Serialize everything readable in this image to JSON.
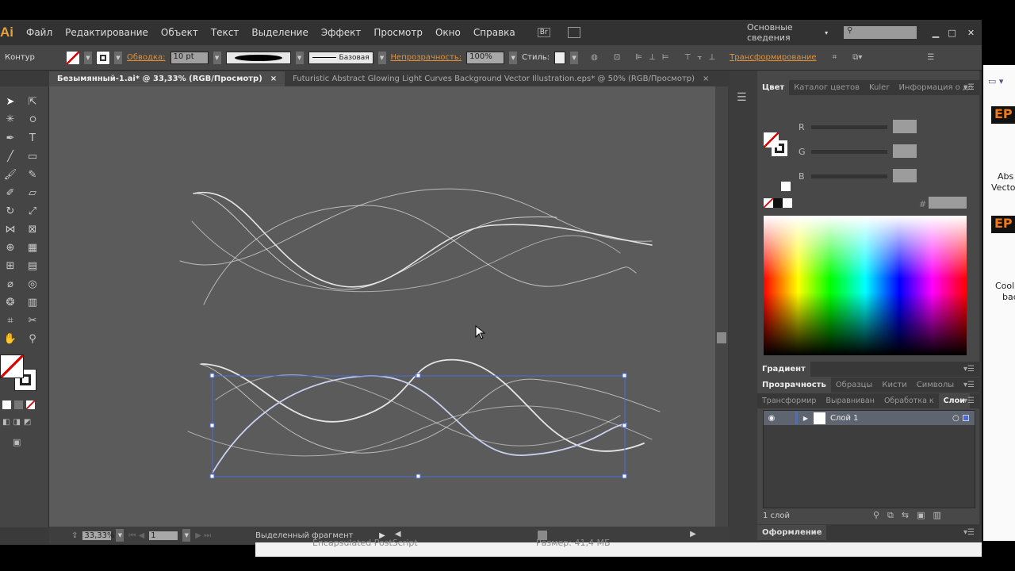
{
  "app": {
    "logo": "Ai",
    "menu": [
      "Файл",
      "Редактирование",
      "Объект",
      "Текст",
      "Выделение",
      "Эффект",
      "Просмотр",
      "Окно",
      "Справка"
    ],
    "bridge": "Br",
    "workspace": "Основные сведения",
    "search_placeholder": ""
  },
  "control": {
    "mode": "Контур",
    "stroke_label": "Обводка:",
    "stroke_weight": "10 pt",
    "profile": "Базовая",
    "opacity_label": "Непрозрачность:",
    "opacity": "100%",
    "styles_label": "Стиль:",
    "transform": "Трансформирование"
  },
  "tabs": [
    {
      "label": "Безымянный-1.ai* @ 33,33% (RGB/Просмотр)",
      "active": true
    },
    {
      "label": "Futuristic Abstract Glowing Light Curves Background Vector Illustration.eps* @ 50% (RGB/Просмотр)",
      "active": false
    }
  ],
  "color_panel": {
    "tabs": [
      "Цвет",
      "Каталог цветов",
      "Kuler",
      "Информация о до"
    ],
    "channels": [
      "R",
      "G",
      "B"
    ],
    "hex_label": "#"
  },
  "gradient_panel": {
    "title": "Градиент"
  },
  "transparency_panel": {
    "tabs": [
      "Прозрачность",
      "Образцы",
      "Кисти",
      "Символы"
    ]
  },
  "layers_panel": {
    "tabs": [
      "Трансформир",
      "Выравниван",
      "Обработка к",
      "Слои"
    ],
    "layers": [
      {
        "name": "Слой 1"
      }
    ],
    "count": "1 слой"
  },
  "appearance_panel": {
    "title": "Оформление"
  },
  "status": {
    "zoom": "33,33%",
    "artboard": "1",
    "info": "Выделенный фрагмент"
  },
  "explorer": {
    "type": "Encapsulated PostScript",
    "size": "Размер: 41,4 МБ",
    "items": [
      {
        "badge": "EP",
        "line1": "Abs",
        "line2": "Vecto"
      },
      {
        "badge": "EP",
        "line1": "Cool",
        "line2": "bac"
      }
    ]
  },
  "colors": {
    "accent": "#e0913a",
    "selection": "#4a6cd8",
    "canvas": "#5b5b5b"
  }
}
